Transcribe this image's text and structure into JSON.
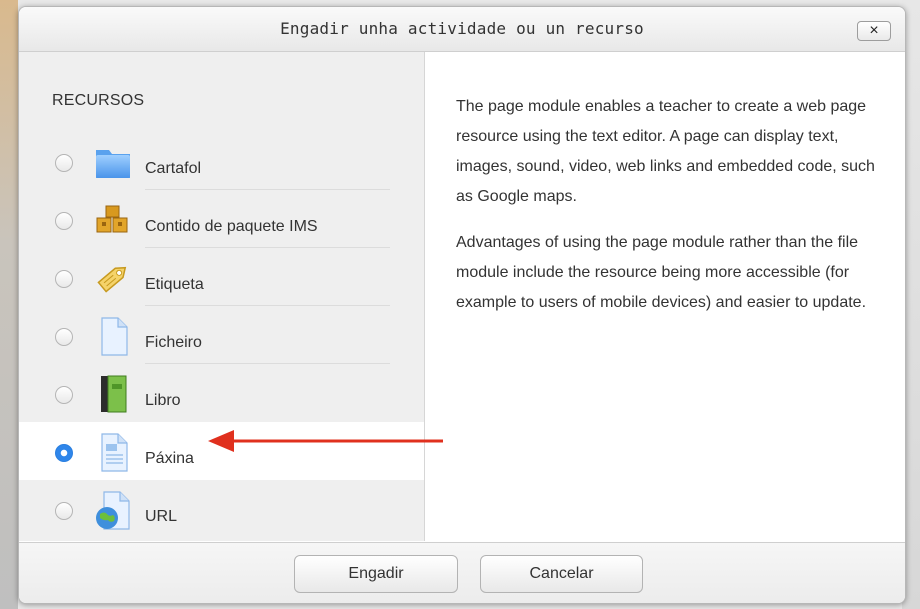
{
  "dialog": {
    "title": "Engadir unha actividade ou un recurso",
    "close_label": "×"
  },
  "resources": {
    "heading": "RECURSOS",
    "items": [
      {
        "label": "Cartafol",
        "icon": "folder-icon",
        "checked": false
      },
      {
        "label": "Contido de paquete IMS",
        "icon": "ims-package-icon",
        "checked": false
      },
      {
        "label": "Etiqueta",
        "icon": "label-tag-icon",
        "checked": false
      },
      {
        "label": "Ficheiro",
        "icon": "file-icon",
        "checked": false
      },
      {
        "label": "Libro",
        "icon": "book-icon",
        "checked": false
      },
      {
        "label": "Páxina",
        "icon": "page-icon",
        "checked": true
      },
      {
        "label": "URL",
        "icon": "url-globe-icon",
        "checked": false
      }
    ]
  },
  "description": {
    "paragraph1": "The page module enables a teacher to create a web page resource using the text editor. A page can display text, images, sound, video, web links and embedded code, such as Google maps.",
    "paragraph2": "Advantages of using the page module rather than the file module include the resource being more accessible (for example to users of mobile devices) and easier to update."
  },
  "footer": {
    "add_label": "Engadir",
    "cancel_label": "Cancelar"
  },
  "colors": {
    "selection_radio": "#2f86ea",
    "annotation_arrow": "#e0301e"
  }
}
